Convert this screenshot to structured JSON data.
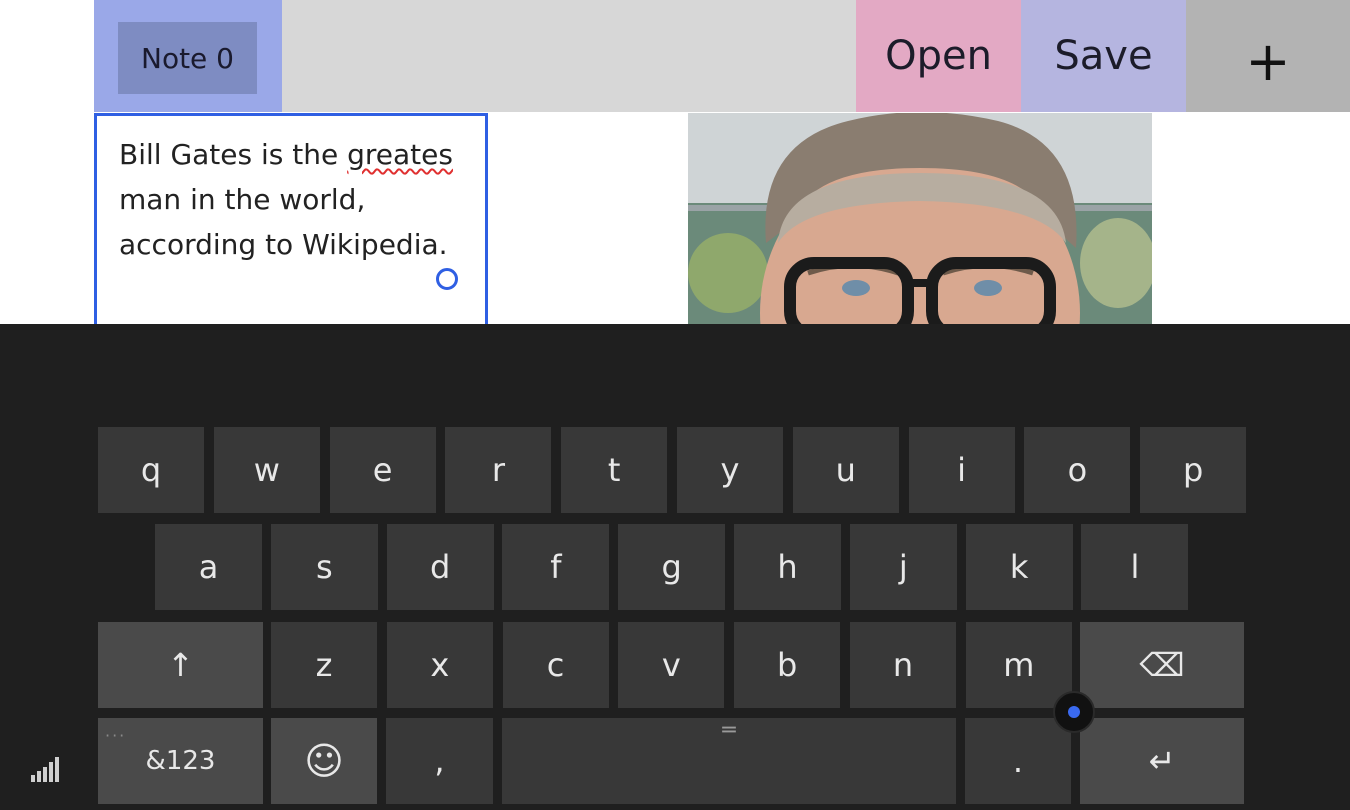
{
  "toolbar": {
    "note_tab_label": "Note 0",
    "open_label": "Open",
    "save_label": "Save",
    "add_label": "+"
  },
  "note": {
    "line1_prefix": "Bill Gates is the ",
    "misspelled_word": "greates",
    "rest_text": "\nman in the world,\naccording to Wikipedia."
  },
  "keyboard": {
    "row1": [
      "q",
      "w",
      "e",
      "r",
      "t",
      "y",
      "u",
      "i",
      "o",
      "p"
    ],
    "row2": [
      "a",
      "s",
      "d",
      "f",
      "g",
      "h",
      "j",
      "k",
      "l"
    ],
    "row3": [
      "z",
      "x",
      "c",
      "v",
      "b",
      "n",
      "m"
    ],
    "shift_label": "↑",
    "backspace_label": "⌫",
    "symbols_label": "&123",
    "emoji_label": "☺",
    "comma_label": ",",
    "period_label": ".",
    "enter_label": "↵",
    "space_handle_label": "═"
  },
  "colors": {
    "accent_blue": "#2f5fe3",
    "note_tab_bg": "#9aa8e8",
    "open_bg": "#e3a9c4",
    "save_bg": "#b5b5e0",
    "keyboard_bg": "#1f1f1f"
  }
}
